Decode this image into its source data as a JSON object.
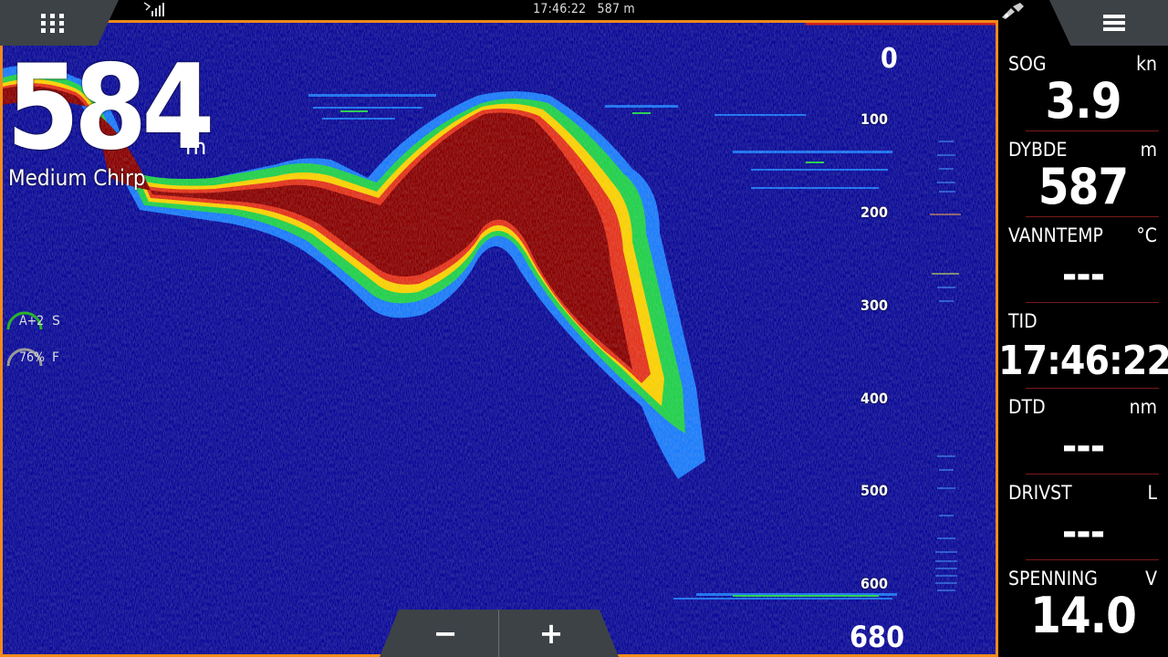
{
  "status": {
    "time": "17:46:22",
    "depth": "587 m"
  },
  "depth": {
    "value": "584",
    "unit": "m",
    "frequency": "Medium Chirp"
  },
  "gauges": [
    {
      "label": "A+2",
      "tag": "S",
      "color": "#2bb32b"
    },
    {
      "label": "76%",
      "tag": "F",
      "color": "#9a9a9a"
    }
  ],
  "scale": {
    "top": "0",
    "bottom": "680",
    "ticks": [
      "100",
      "200",
      "300",
      "400",
      "500",
      "600"
    ]
  },
  "zoom": {
    "minus": "−",
    "plus": "+"
  },
  "panel": [
    {
      "label": "SOG",
      "unit": "kn",
      "value": "3.9"
    },
    {
      "label": "DYBDE",
      "unit": "m",
      "value": "587"
    },
    {
      "label": "VANNTEMP",
      "unit": "°C",
      "value": "---"
    },
    {
      "label": "TID",
      "unit": "",
      "value": "17:46:22"
    },
    {
      "label": "DTD",
      "unit": "nm",
      "value": "---"
    },
    {
      "label": "DRIVST",
      "unit": "L",
      "value": "---"
    },
    {
      "label": "SPENNING",
      "unit": "V",
      "value": "14.0"
    }
  ],
  "colors": {
    "frame": "#f08a1a",
    "water": "#0a0a9a",
    "bottom": "#8b0000"
  },
  "icons": [
    "apps-grid-icon",
    "menu-icon",
    "signal-icon",
    "satellite-icon"
  ]
}
